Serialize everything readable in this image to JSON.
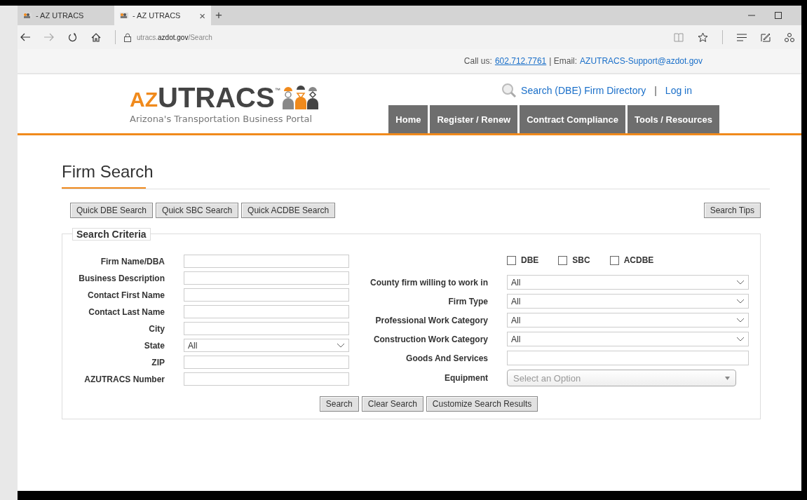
{
  "browser": {
    "tabs": [
      {
        "label": "- AZ UTRACS",
        "selected": false
      },
      {
        "label": "- AZ UTRACS",
        "selected": true,
        "close": "×"
      }
    ],
    "new_tab": "+",
    "url": "utracs.**azdot.gov**/Search"
  },
  "topbar": {
    "call_label": "Call us:",
    "phone": "602.712.7761",
    "separator": "| Email:",
    "email": "AZUTRACS-Support@azdot.gov"
  },
  "header": {
    "logo": {
      "prefix": "AZ",
      "name": "UTRACS",
      "mark": "™",
      "tagline": "Arizona's Transportation Business Portal"
    },
    "directory_link": "Search (DBE) Firm Directory",
    "divider": "|",
    "login_link": "Log in",
    "nav": [
      {
        "label": "Home"
      },
      {
        "label": "Register / Renew"
      },
      {
        "label": "Contract Compliance"
      },
      {
        "label": "Tools / Resources"
      }
    ]
  },
  "page": {
    "title": "Firm Search",
    "quick_buttons": [
      "Quick DBE Search",
      "Quick SBC Search",
      "Quick ACDBE Search"
    ],
    "tips_button": "Search Tips",
    "criteria": {
      "legend": "Search Criteria",
      "left_fields": [
        {
          "label": "Firm Name/DBA",
          "kind": "text"
        },
        {
          "label": "Business Description",
          "kind": "text"
        },
        {
          "label": "Contact First Name",
          "kind": "text"
        },
        {
          "label": "Contact Last Name",
          "kind": "text"
        },
        {
          "label": "City",
          "kind": "text"
        },
        {
          "label": "State",
          "kind": "select",
          "value": "All"
        },
        {
          "label": "ZIP",
          "kind": "text"
        },
        {
          "label": "AZUTRACS Number",
          "kind": "text"
        }
      ],
      "checkboxes": [
        {
          "label": "DBE",
          "checked": false
        },
        {
          "label": "SBC",
          "checked": false
        },
        {
          "label": "ACDBE",
          "checked": false
        }
      ],
      "right_fields": [
        {
          "label": "County firm willing to work in",
          "kind": "select",
          "value": "All"
        },
        {
          "label": "Firm Type",
          "kind": "select",
          "value": "All"
        },
        {
          "label": "Professional Work Category",
          "kind": "select",
          "value": "All"
        },
        {
          "label": "Construction Work Category",
          "kind": "select",
          "value": "All"
        },
        {
          "label": "Goods And Services",
          "kind": "text"
        },
        {
          "label": "Equipment",
          "kind": "combo",
          "placeholder": "Select an Option"
        }
      ],
      "actions": [
        "Search",
        "Clear Search",
        "Customize Search Results"
      ]
    }
  }
}
